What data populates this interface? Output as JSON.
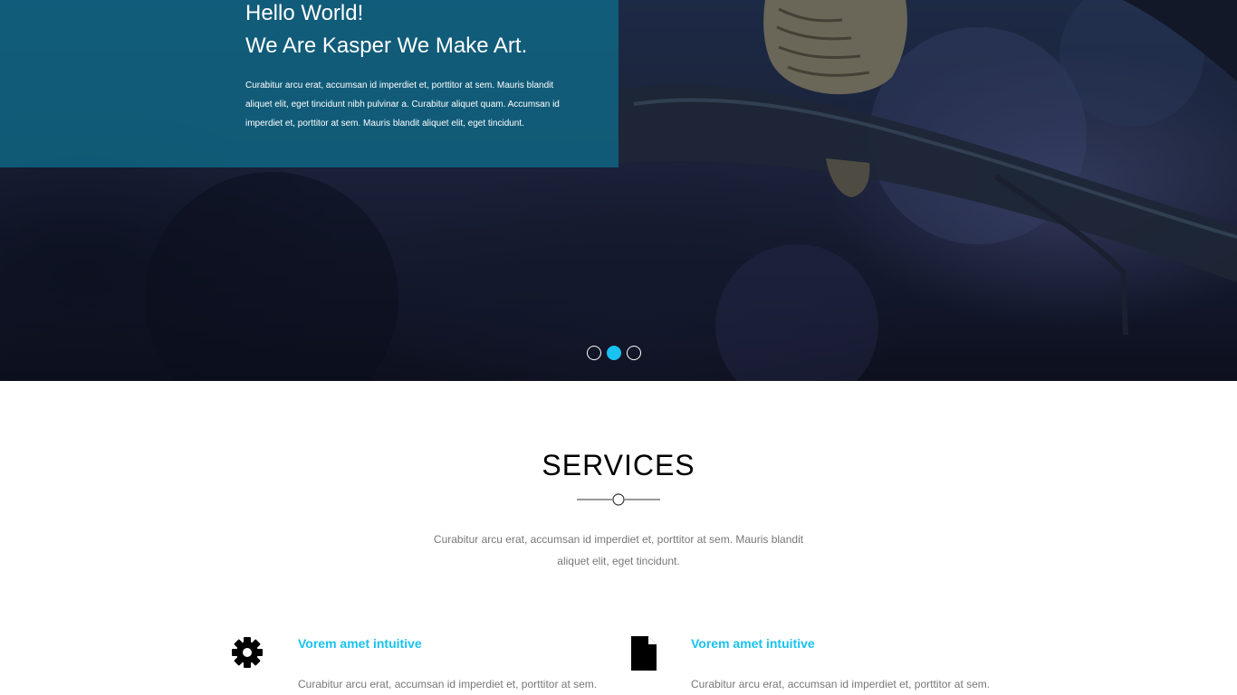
{
  "hero": {
    "title": "Hello World!",
    "subtitle": "We Are Kasper We Make Art.",
    "paragraph": "Curabitur arcu erat, accumsan id imperdiet et, porttitor at sem. Mauris blandit aliquet elit, eget tincidunt nibh pulvinar a. Curabitur aliquet quam. Accumsan id imperdiet et, porttitor at sem. Mauris blandit aliquet elit, eget tincidunt.",
    "slider": {
      "count": 3,
      "active_index": 1,
      "active_color": "#19c2f0"
    },
    "overlay_color": "#0f6987"
  },
  "services": {
    "title": "SERVICES",
    "description": "Curabitur arcu erat, accumsan id imperdiet et, porttitor at sem. Mauris blandit aliquet elit, eget tincidunt.",
    "items": [
      {
        "icon": "gear-icon",
        "heading": "Vorem amet intuitive",
        "body": "Curabitur arcu erat, accumsan id imperdiet et, porttitor at sem."
      },
      {
        "icon": "document-icon",
        "heading": "Vorem amet intuitive",
        "body": "Curabitur arcu erat, accumsan id imperdiet et, porttitor at sem."
      }
    ],
    "accent_color": "#19c2f0"
  }
}
